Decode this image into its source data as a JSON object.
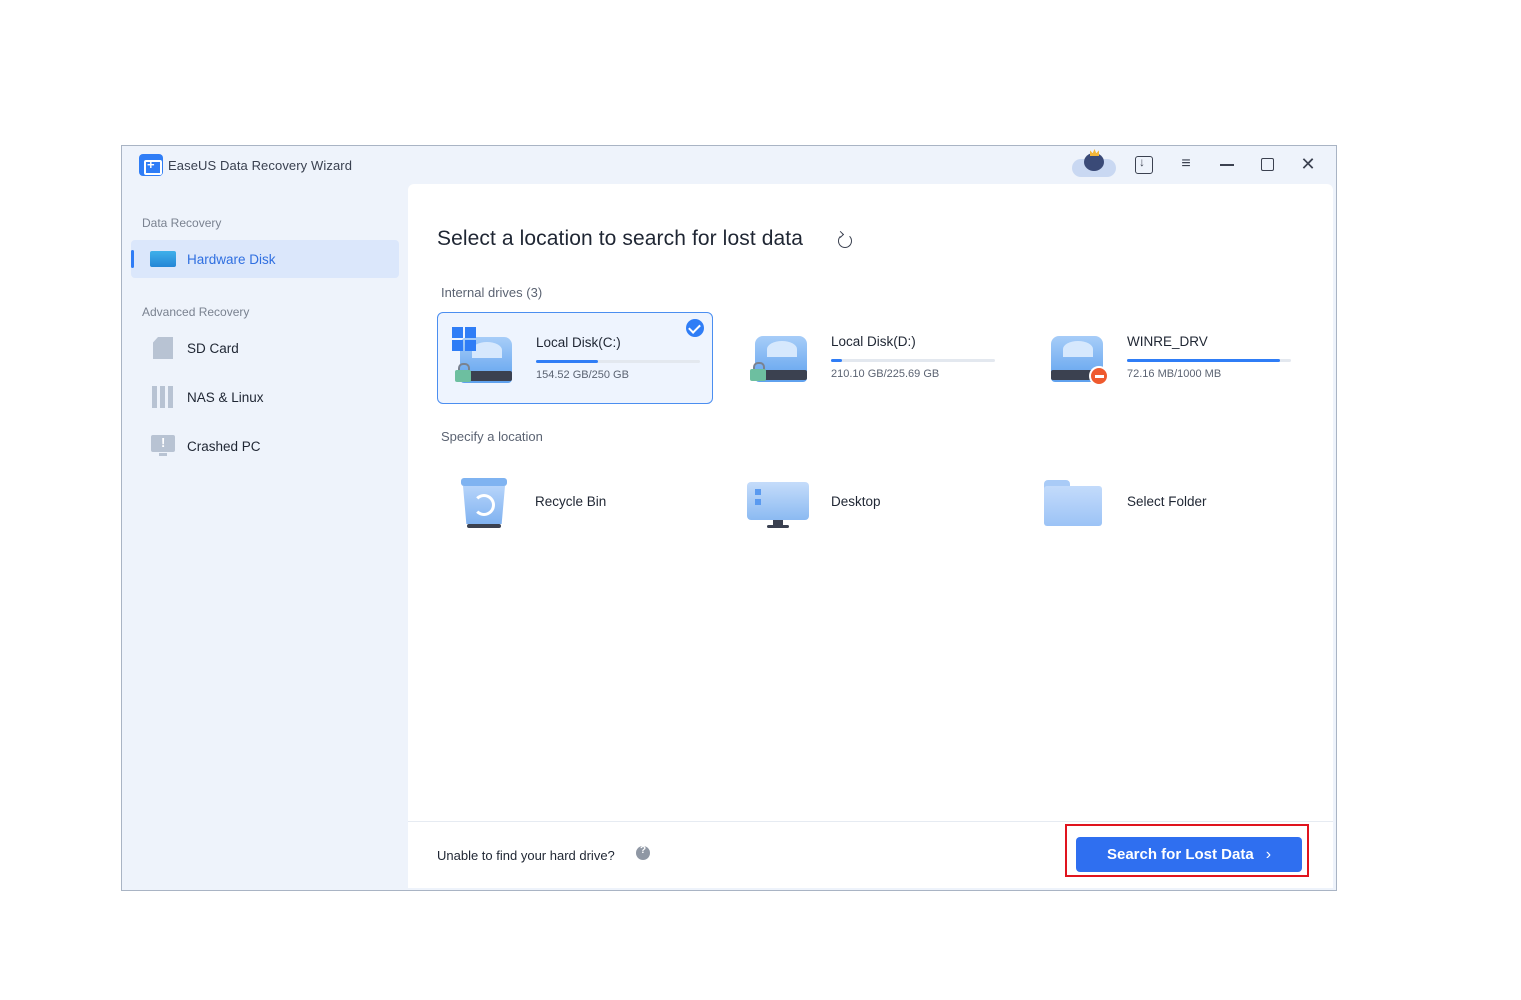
{
  "window": {
    "title": "EaseUS Data Recovery Wizard"
  },
  "sidebar": {
    "section_data_recovery": "Data Recovery",
    "section_advanced": "Advanced Recovery",
    "items": [
      {
        "label": "Hardware Disk",
        "icon": "hard-disk-icon",
        "active": true
      },
      {
        "label": "SD Card",
        "icon": "sd-card-icon",
        "active": false
      },
      {
        "label": "NAS & Linux",
        "icon": "nas-icon",
        "active": false
      },
      {
        "label": "Crashed PC",
        "icon": "crashed-pc-icon",
        "active": false
      }
    ]
  },
  "main": {
    "title": "Select a location to search for lost data",
    "internal_drives_label": "Internal drives (3)",
    "drives": [
      {
        "name": "Local Disk(C:)",
        "size": "154.52 GB/250 GB",
        "used_fraction": 0.38,
        "selected": true
      },
      {
        "name": "Local Disk(D:)",
        "size": "210.10 GB/225.69 GB",
        "used_fraction": 0.07,
        "selected": false
      },
      {
        "name": "WINRE_DRV",
        "size": "72.16 MB/1000 MB",
        "used_fraction": 0.93,
        "selected": false
      }
    ],
    "specify_location_label": "Specify a location",
    "locations": [
      {
        "name": "Recycle Bin"
      },
      {
        "name": "Desktop"
      },
      {
        "name": "Select Folder"
      }
    ]
  },
  "footer": {
    "help_text": "Unable to find your hard drive?",
    "search_button": "Search for Lost Data"
  },
  "colors": {
    "accent": "#2f6ff0",
    "highlight_box": "#e0141e"
  }
}
